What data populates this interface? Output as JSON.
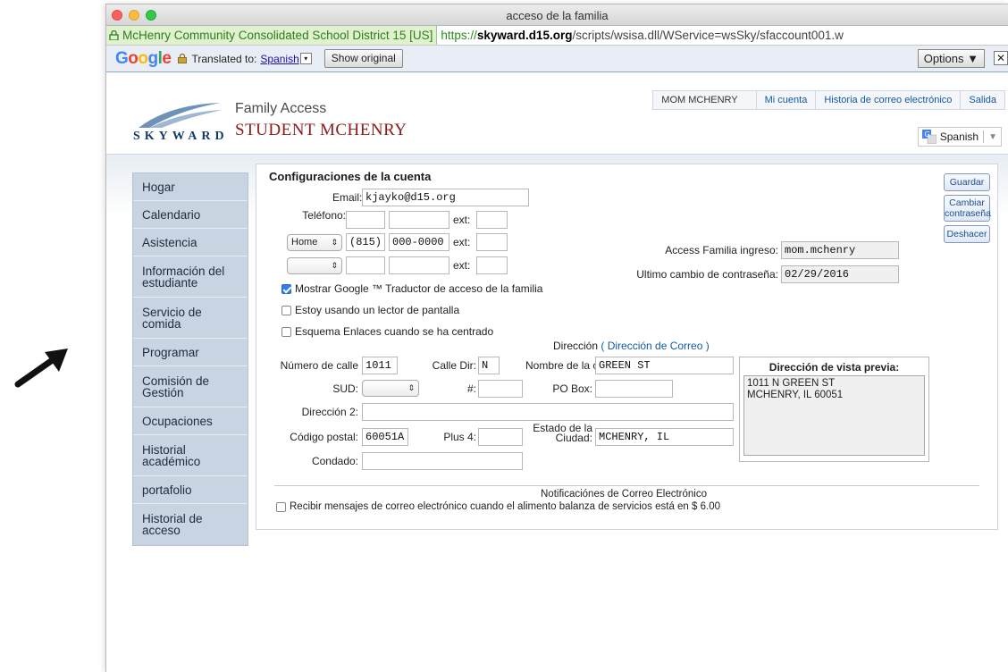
{
  "window": {
    "title": "acceso de la familia",
    "cert_label": "McHenry Community Consolidated School District 15 [US]",
    "url_scheme": "https://",
    "url_host": "skyward.d15.org",
    "url_path": "/scripts/wsisa.dll/WService=wsSky/sfaccount001.w"
  },
  "translate_bar": {
    "translated_to": "Translated to:",
    "language": "Spanish",
    "show_original": "Show original",
    "options": "Options ▼",
    "close": "✕"
  },
  "header": {
    "logo_text": "SKYWARD",
    "family_access": "Family Access",
    "student_name": "STUDENT MCHENRY",
    "nav": [
      "MOM MCHENRY",
      "Mi cuenta",
      "Historia de correo electrónico",
      "Salida"
    ],
    "language_select": "Spanish"
  },
  "sidebar": {
    "items": [
      "Hogar",
      "Calendario",
      "Asistencia",
      "Información del estudiante",
      "Servicio de comida",
      "Programar",
      "Comisión de Gestión",
      "Ocupaciones",
      "Historial académico",
      "portafolio",
      "Historial de acceso"
    ]
  },
  "form": {
    "title": "Configuraciones de la cuenta",
    "email_label": "Email:",
    "email_value": "kjayko@d15.org",
    "phone_label": "Teléfono:",
    "ext_label": "ext:",
    "phone2_type": "Home",
    "phone2_area": "(815)",
    "phone2_number": "000-0000",
    "login_label": "Access Familia ingreso:",
    "login_value": "mom.mchenry",
    "pw_change_label": "Ultimo cambio de contraseña:",
    "pw_change_value": "02/29/2016",
    "cb_google": "Mostrar Google ™ Traductor de acceso de la familia",
    "cb_reader": "Estoy usando un lector de pantalla",
    "cb_links": "Esquema Enlaces cuando se ha centrado",
    "address_heading": "Dirección",
    "mail_address_link": "( Dirección de Correo )",
    "street_num_label": "Número de calle",
    "street_num_value": "1011",
    "street_dir_label": "Calle Dir:",
    "street_dir_value": "N",
    "street_name_label": "Nombre de la c",
    "street_name_value": "GREEN ST",
    "sud_label": "SUD:",
    "hash_label": "#:",
    "po_box_label": "PO Box:",
    "address2_label": "Dirección 2:",
    "zip_label": "Código postal:",
    "zip_value": "60051A",
    "plus4_label": "Plus 4:",
    "city_state_label_1": "Estado de la",
    "city_state_label_2": "Ciudad:",
    "city_state_value": "MCHENRY, IL",
    "county_label": "Condado:",
    "preview_title": "Dirección de vista previa:",
    "preview_text": "1011 N GREEN ST\nMCHENRY, IL 60051",
    "email_notif_heading": "Notificaciónes de Correo Electrónico",
    "cb_food": "Recibir mensajes de correo electrónico cuando el alimento balanza de servicios está en $ 6.00",
    "save_btn": "Guardar",
    "change_pw_btn": "Cambiar contraseña",
    "undo_btn": "Deshacer"
  }
}
